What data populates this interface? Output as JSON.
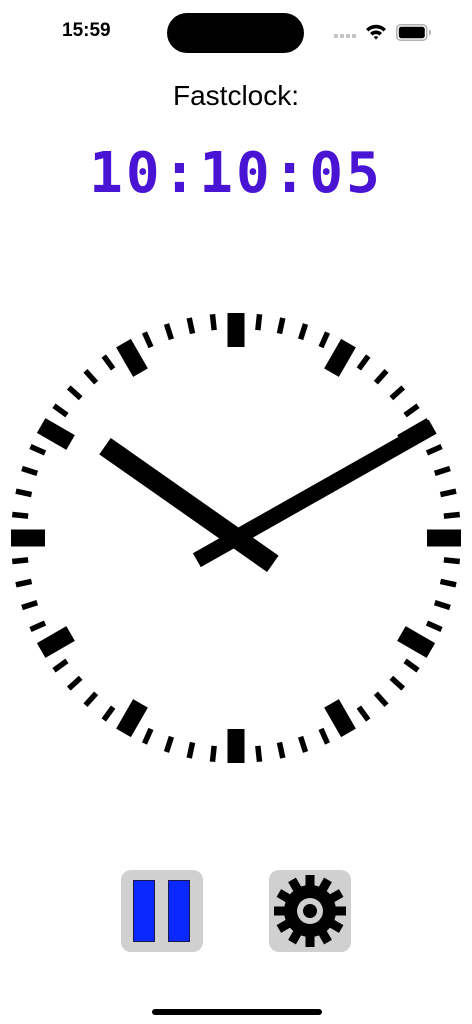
{
  "status_bar": {
    "time": "15:59",
    "icons": [
      "cellular-signal-icon",
      "wifi-icon",
      "battery-icon"
    ]
  },
  "title": "Fastclock:",
  "digital_time": "10:10:05",
  "clock": {
    "hours": 10,
    "minutes": 10,
    "seconds": 5,
    "hand_color": "#000000",
    "tick_color": "#000000"
  },
  "controls": {
    "pause_button": {
      "icon": "pause-icon",
      "bar_color": "#0a28ff",
      "background": "#d0d0d0"
    },
    "settings_button": {
      "icon": "gear-icon",
      "background": "#d0d0d0"
    }
  },
  "colors": {
    "digital_time": "#4a14d4",
    "background": "#ffffff"
  }
}
